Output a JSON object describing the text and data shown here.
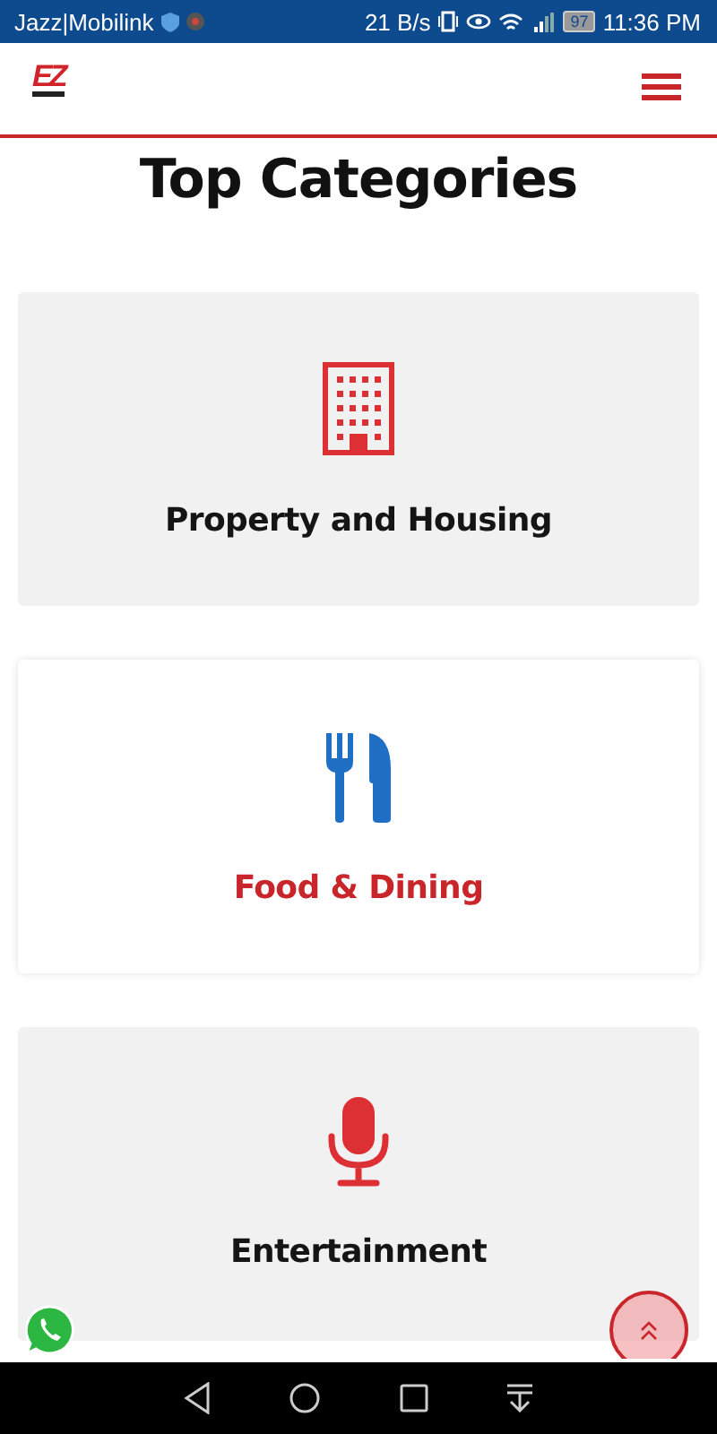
{
  "status_bar": {
    "carrier": "Jazz|Mobilink",
    "speed": "21 B/s",
    "battery": "97",
    "time": "11:36 PM"
  },
  "header": {
    "logo": "EZ"
  },
  "title": "Top Categories",
  "categories": [
    {
      "kind": "building",
      "label": "Property and Housing",
      "selected": false
    },
    {
      "kind": "food",
      "label": "Food & Dining",
      "selected": true
    },
    {
      "kind": "microphone",
      "label": "Entertainment",
      "selected": false
    }
  ]
}
